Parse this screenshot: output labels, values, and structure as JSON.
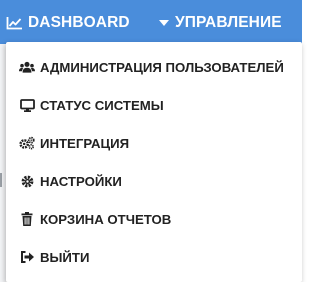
{
  "navbar": {
    "dashboard": {
      "label": "DASHBOARD",
      "icon": "line-chart-icon"
    },
    "manage": {
      "label": "УПРАВЛЕНИЕ",
      "icon": "caret-down-icon"
    },
    "color": "#4a8ddb"
  },
  "dropdown": {
    "items": [
      {
        "label": "АДМИНИСТРАЦИЯ ПОЛЬЗОВАТЕЛЕЙ",
        "icon": "users-icon"
      },
      {
        "label": "СТАТУС СИСТЕМЫ",
        "icon": "desktop-icon"
      },
      {
        "label": "ИНТЕГРАЦИЯ",
        "icon": "cogs-icon"
      },
      {
        "label": "НАСТРОЙКИ",
        "icon": "gear-icon"
      },
      {
        "label": "КОРЗИНА ОТЧЕТОВ",
        "icon": "trash-icon"
      },
      {
        "label": "ВЫЙТИ",
        "icon": "sign-out-icon"
      }
    ]
  }
}
